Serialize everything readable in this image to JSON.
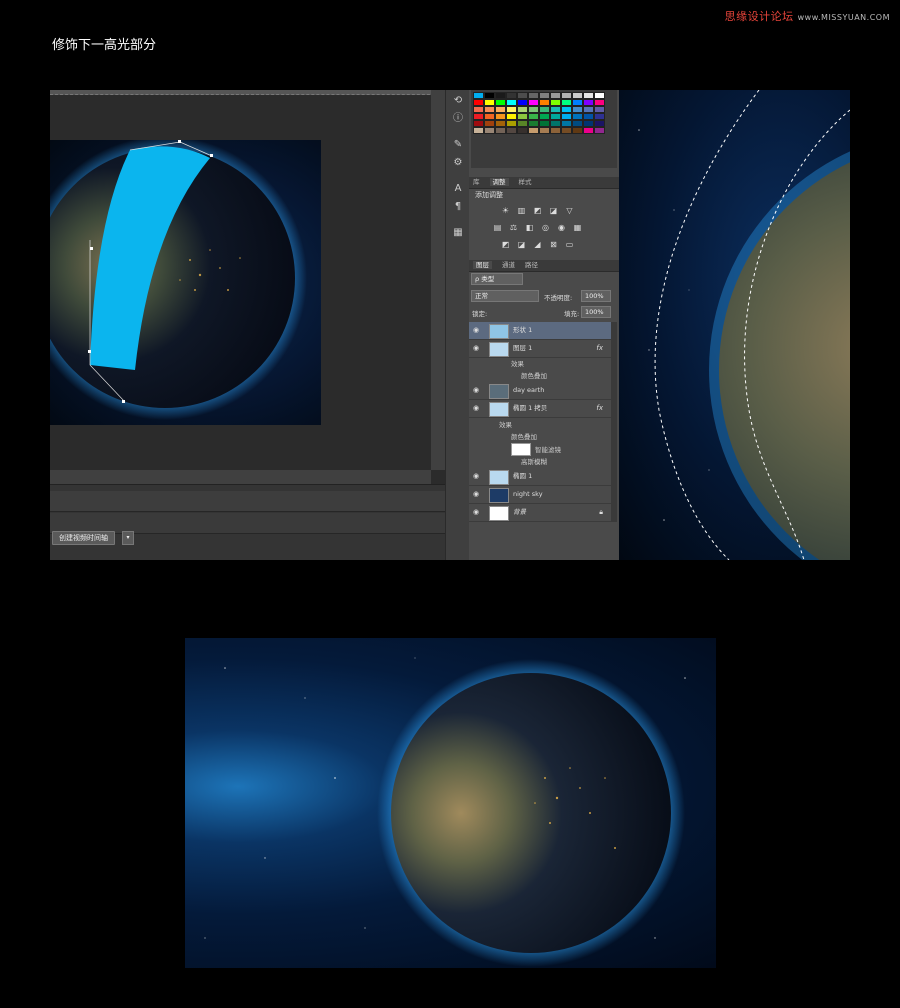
{
  "page": {
    "title": "修饰下一高光部分"
  },
  "watermark": {
    "brand": "思缘设计论坛",
    "url": "www.MISSYUAN.COM"
  },
  "timeline": {
    "create_button_label": "创建视频时间轴",
    "dropdown_glyph": "▾"
  },
  "tools": [
    {
      "icon": "history-brush-icon",
      "glyph": "⟲"
    },
    {
      "icon": "info-icon",
      "glyph": "ⓘ"
    },
    {
      "icon": "brush-tool-icon",
      "glyph": "✎"
    },
    {
      "icon": "adjust-sliders-icon",
      "glyph": "⚙"
    },
    {
      "icon": "character-icon",
      "glyph": "A"
    },
    {
      "icon": "paragraph-icon",
      "glyph": "¶"
    },
    {
      "icon": "grid-icon",
      "glyph": "▦"
    }
  ],
  "swatches": {
    "colors": [
      "#00aef0",
      "#000000",
      "#1a1a1a",
      "#333333",
      "#4d4d4d",
      "#666666",
      "#808080",
      "#999999",
      "#b3b3b3",
      "#cccccc",
      "#e6e6e6",
      "#ffffff",
      "#ff0000",
      "#ffff00",
      "#00ff00",
      "#00ffff",
      "#0000ff",
      "#ff00ff",
      "#ff8000",
      "#80ff00",
      "#00ff80",
      "#0080ff",
      "#8000ff",
      "#ff0080",
      "#f26c4f",
      "#f68e55",
      "#fbaf5c",
      "#fff467",
      "#acd372",
      "#7cc576",
      "#3bb878",
      "#1abbb4",
      "#00bff3",
      "#438ccb",
      "#5574b9",
      "#605ca8",
      "#ed1c24",
      "#f26522",
      "#f7941d",
      "#fff200",
      "#8dc63f",
      "#39b54a",
      "#00a651",
      "#00a99d",
      "#00aeef",
      "#0072bc",
      "#0054a6",
      "#2e3192",
      "#9e0b0f",
      "#a0410d",
      "#a36209",
      "#aba000",
      "#598527",
      "#1a7b30",
      "#007236",
      "#00746b",
      "#0076a3",
      "#004b80",
      "#003471",
      "#1b1464",
      "#c7b299",
      "#998675",
      "#736357",
      "#534741",
      "#37302d",
      "#c69c6d",
      "#a67c52",
      "#8c6239",
      "#754c24",
      "#603913",
      "#ec008c",
      "#92278f"
    ]
  },
  "tabs_adjust": [
    {
      "label": "库",
      "active": false
    },
    {
      "label": "调整",
      "active": true
    },
    {
      "label": "样式",
      "active": false
    }
  ],
  "adjustments": {
    "title": "添加调整",
    "row1": [
      {
        "icon": "brightness-icon",
        "glyph": "☀"
      },
      {
        "icon": "levels-icon",
        "glyph": "▥"
      },
      {
        "icon": "curves-icon",
        "glyph": "◩"
      },
      {
        "icon": "exposure-icon",
        "glyph": "◪"
      },
      {
        "icon": "vibrance-icon",
        "glyph": "▽"
      }
    ],
    "row2": [
      {
        "icon": "hue-sat-icon",
        "glyph": "▤"
      },
      {
        "icon": "color-balance-icon",
        "glyph": "⚖"
      },
      {
        "icon": "bw-icon",
        "glyph": "◧"
      },
      {
        "icon": "photo-filter-icon",
        "glyph": "◎"
      },
      {
        "icon": "channel-mixer-icon",
        "glyph": "◉"
      },
      {
        "icon": "color-lookup-icon",
        "glyph": "▦"
      }
    ],
    "row3": [
      {
        "icon": "invert-icon",
        "glyph": "◩"
      },
      {
        "icon": "posterize-icon",
        "glyph": "◪"
      },
      {
        "icon": "threshold-icon",
        "glyph": "◢"
      },
      {
        "icon": "selective-color-icon",
        "glyph": "⊠"
      },
      {
        "icon": "gradient-map-icon",
        "glyph": "▭"
      }
    ]
  },
  "tabs_layers": [
    {
      "label": "图层",
      "active": true
    },
    {
      "label": "通道",
      "active": false
    },
    {
      "label": "路径",
      "active": false
    }
  ],
  "layers_controls": {
    "filter_kind": "ρ 类型",
    "blend_mode": "正常",
    "opacity_label": "不透明度:",
    "opacity_value": "100%",
    "lock_label": "锁定:",
    "fill_label": "填充:",
    "fill_value": "100%"
  },
  "layers": [
    {
      "name": "形状 1",
      "selected": true,
      "fx": "",
      "thumb": "#8fc5e6"
    },
    {
      "name": "图层 1",
      "selected": false,
      "fx": "fx",
      "thumb": "#b9d9ef"
    },
    {
      "name": "day earth",
      "selected": false,
      "fx": "",
      "thumb": "#5a6d7a"
    },
    {
      "name": "椭圆 1 拷贝",
      "selected": false,
      "fx": "fx",
      "thumb": "#b9d9ef"
    },
    {
      "name": "椭圆 1",
      "selected": false,
      "fx": "",
      "thumb": "#b9d9ef"
    },
    {
      "name": "night sky",
      "selected": false,
      "fx": "",
      "thumb": "#1d3b66"
    },
    {
      "name": "背景",
      "selected": false,
      "fx": "",
      "thumb": "#ffffff"
    }
  ],
  "layer_effects": {
    "effects_label": "效果",
    "color_overlay": "颜色叠加",
    "smart_filters": "智能滤镜",
    "gaussian_blur": "高斯模糊"
  },
  "colors": {
    "highlight_shape": "#0bb5ee",
    "glow": "#2fa8ff",
    "selected_layer": "#5c6a80"
  }
}
